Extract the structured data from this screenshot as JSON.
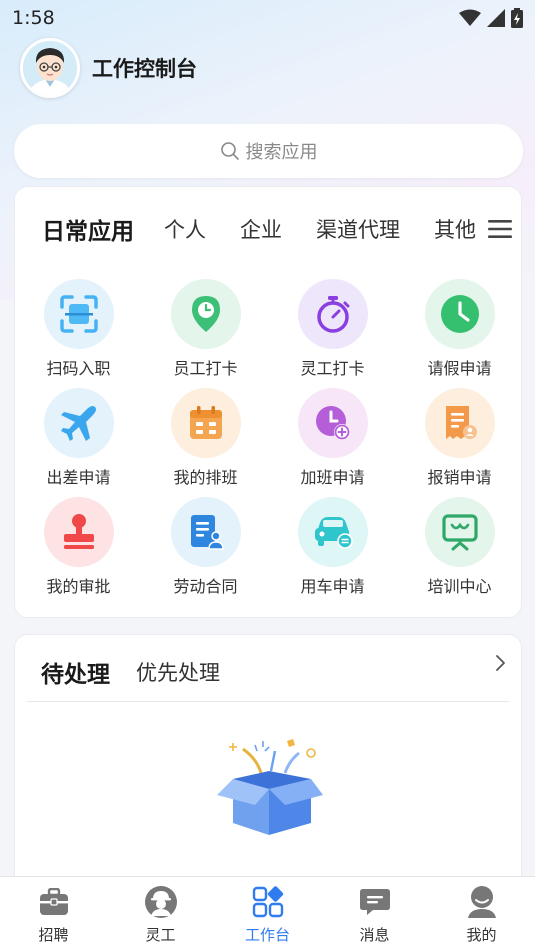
{
  "status_bar": {
    "time": "1:58"
  },
  "header": {
    "title": "工作控制台"
  },
  "search": {
    "placeholder": "搜索应用"
  },
  "apps_tabs": [
    "日常应用",
    "个人",
    "企业",
    "渠道代理",
    "其他"
  ],
  "apps": [
    {
      "label": "扫码入职",
      "icon": "scan-icon"
    },
    {
      "label": "员工打卡",
      "icon": "location-pin-icon"
    },
    {
      "label": "灵工打卡",
      "icon": "stopwatch-icon"
    },
    {
      "label": "请假申请",
      "icon": "clock-icon"
    },
    {
      "label": "出差申请",
      "icon": "airplane-icon"
    },
    {
      "label": "我的排班",
      "icon": "calendar-icon"
    },
    {
      "label": "加班申请",
      "icon": "overtime-clock-icon"
    },
    {
      "label": "报销申请",
      "icon": "receipt-icon"
    },
    {
      "label": "我的审批",
      "icon": "stamp-icon"
    },
    {
      "label": "劳动合同",
      "icon": "contract-icon"
    },
    {
      "label": "用车申请",
      "icon": "car-icon"
    },
    {
      "label": "培训中心",
      "icon": "training-board-icon"
    }
  ],
  "todo": {
    "tab_active": "待处理",
    "tab_other": "优先处理"
  },
  "bottom_nav": [
    {
      "label": "招聘",
      "icon": "briefcase-icon"
    },
    {
      "label": "灵工",
      "icon": "worker-icon"
    },
    {
      "label": "工作台",
      "icon": "dashboard-icon",
      "active": true
    },
    {
      "label": "消息",
      "icon": "message-icon"
    },
    {
      "label": "我的",
      "icon": "profile-icon"
    }
  ],
  "colors": {
    "accent": "#2f7bf0",
    "background": "#f4f5f9"
  }
}
